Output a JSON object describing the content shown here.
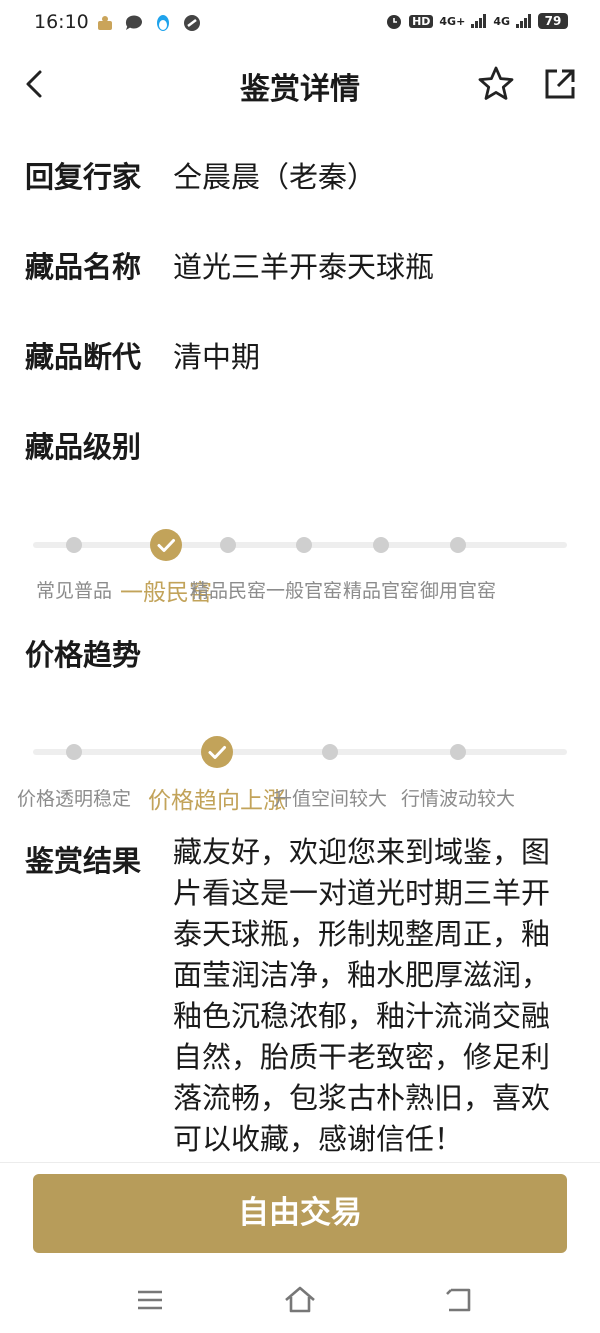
{
  "status_bar": {
    "time": "16:10",
    "hd_label": "HD",
    "signal1": "4G+",
    "signal2": "4G",
    "battery": "79"
  },
  "header": {
    "title": "鉴赏详情"
  },
  "details": [
    {
      "label": "回复行家",
      "value": "仝晨晨（老秦）"
    },
    {
      "label": "藏品名称",
      "value": "道光三羊开泰天球瓶"
    },
    {
      "label": "藏品断代",
      "value": "清中期"
    }
  ],
  "level": {
    "label": "藏品级别",
    "options": [
      "常见普品",
      "一般民窑",
      "精品民窑",
      "一般官窑",
      "精品官窑",
      "御用官窑"
    ],
    "selected": "一般民窑"
  },
  "price_trend": {
    "label": "价格趋势",
    "options": [
      "价格透明稳定",
      "价格趋向上涨",
      "升值空间较大",
      "行情波动较大"
    ],
    "selected": "价格趋向上涨"
  },
  "result": {
    "label": "鉴赏结果",
    "text": "藏友好，欢迎您来到域鉴，图片看这是一对道光时期三羊开泰天球瓶，形制规整周正，釉面莹润洁净，釉水肥厚滋润，釉色沉稳浓郁，釉汁流淌交融自然，胎质干老致密，修足利落流畅，包浆古朴熟旧，喜欢可以收藏，感谢信任！"
  },
  "action": {
    "trade_label": "自由交易"
  },
  "colors": {
    "accent": "#c2a35a",
    "button": "#b79c5a",
    "inactive_dot": "#cfcfcf",
    "track": "#eeeeee"
  }
}
